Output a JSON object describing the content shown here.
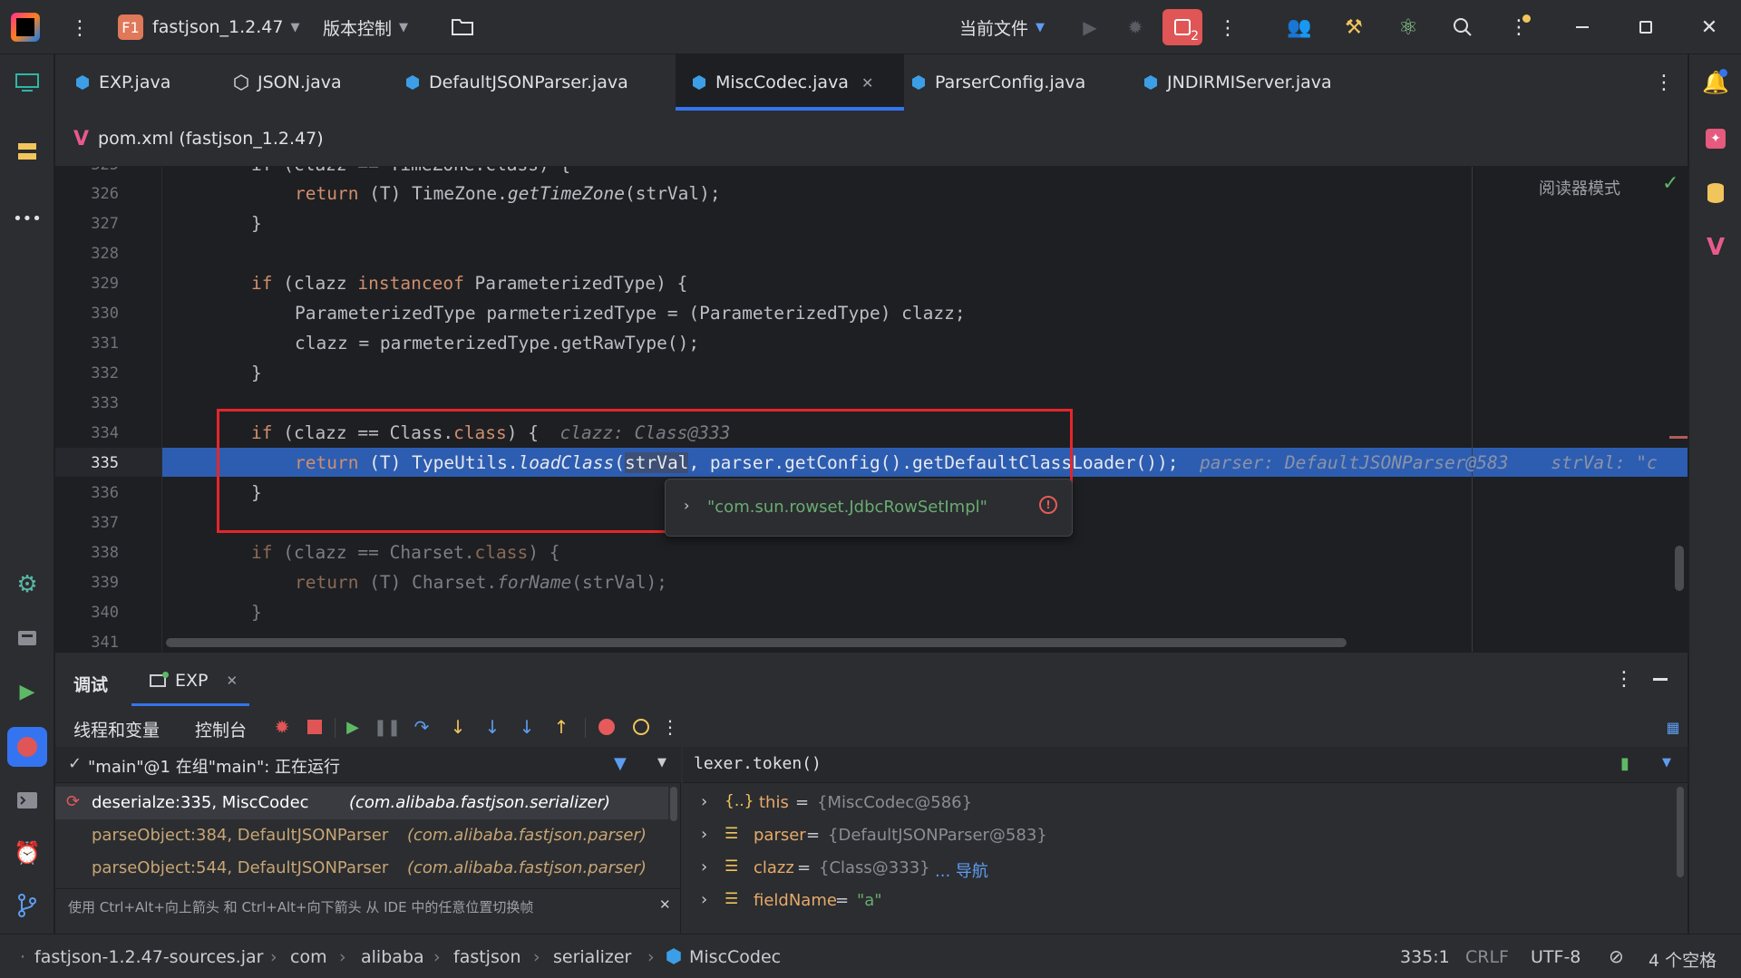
{
  "titlebar": {
    "project_badge": "F1",
    "project_name": "fastjson_1.2.47",
    "vcs_label": "版本控制",
    "run_config": "当前文件",
    "problems_count": "2"
  },
  "tabs": [
    {
      "label": "EXP.java"
    },
    {
      "label": "JSON.java"
    },
    {
      "label": "DefaultJSONParser.java"
    },
    {
      "label": "MiscCodec.java",
      "active": true
    },
    {
      "label": "ParserConfig.java"
    },
    {
      "label": "JNDIRMIServer.java"
    }
  ],
  "tab_row2": {
    "label": "pom.xml (fastjson_1.2.47)"
  },
  "editor": {
    "reader_mode": "阅读器模式",
    "lines": [
      {
        "num": "326",
        "code": "return (T) TimeZone.getTimeZone(strVal);"
      },
      {
        "num": "327",
        "code": "}"
      },
      {
        "num": "328",
        "code": ""
      },
      {
        "num": "329",
        "code": "if (clazz instanceof ParameterizedType) {"
      },
      {
        "num": "330",
        "code": "ParameterizedType parmeterizedType = (ParameterizedType) clazz;"
      },
      {
        "num": "331",
        "code": "clazz = parmeterizedType.getRawType();"
      },
      {
        "num": "332",
        "code": "}"
      },
      {
        "num": "333",
        "code": ""
      },
      {
        "num": "334",
        "code": "if (clazz == Class.class) {",
        "hint": "clazz: Class@333"
      },
      {
        "num": "335",
        "code": "return (T) TypeUtils.loadClass(strVal, parser.getConfig().getDefaultClassLoader());",
        "hint": "parser: DefaultJSONParser@583    strVal: \"c"
      },
      {
        "num": "336",
        "code": "}"
      },
      {
        "num": "337",
        "code": ""
      },
      {
        "num": "338",
        "code": "if (clazz == Charset.class) {"
      },
      {
        "num": "339",
        "code": "return (T) Charset.forName(strVal);"
      },
      {
        "num": "340",
        "code": "}"
      },
      {
        "num": "341",
        "code": ""
      }
    ],
    "popup_value": "\"com.sun.rowset.JdbcRowSetImpl\""
  },
  "debug": {
    "tab_debug": "调试",
    "tab_session": "EXP",
    "subtab_threads": "线程和变量",
    "subtab_console": "控制台",
    "thread_status": "\"main\"@1 在组\"main\": 正在运行",
    "frames": [
      {
        "method": "deserialze:335, MiscCodec",
        "pkg": "(com.alibaba.fastjson.serializer)"
      },
      {
        "method": "parseObject:384, DefaultJSONParser",
        "pkg": "(com.alibaba.fastjson.parser)"
      },
      {
        "method": "parseObject:544, DefaultJSONParser",
        "pkg": "(com.alibaba.fastjson.parser)"
      }
    ],
    "hint_text": "使用 Ctrl+Alt+向上箭头 和 Ctrl+Alt+向下箭头 从 IDE 中的任意位置切换帧",
    "eval_expression": "lexer.token()",
    "variables": [
      {
        "name": "this",
        "eq": " = ",
        "value": "{MiscCodec@586}"
      },
      {
        "name": "parser",
        "eq": " = ",
        "value": "{DefaultJSONParser@583}"
      },
      {
        "name": "clazz",
        "eq": " = ",
        "value": "{Class@333}",
        "extra": "... 导航"
      },
      {
        "name": "fieldName",
        "eq": " = ",
        "value": "\"a\""
      }
    ]
  },
  "statusbar": {
    "crumbs": [
      "fastjson-1.2.47-sources.jar",
      "com",
      "alibaba",
      "fastjson",
      "serializer",
      "MiscCodec"
    ],
    "position": "335:1",
    "line_sep": "CRLF",
    "encoding": "UTF-8",
    "indent": "4 个空格"
  },
  "colors": {
    "accent": "#3574f0",
    "highlight_line": "#2d5db1",
    "red_box": "#e5262b",
    "keyword": "#cf8e6d",
    "string": "#6aab73"
  }
}
